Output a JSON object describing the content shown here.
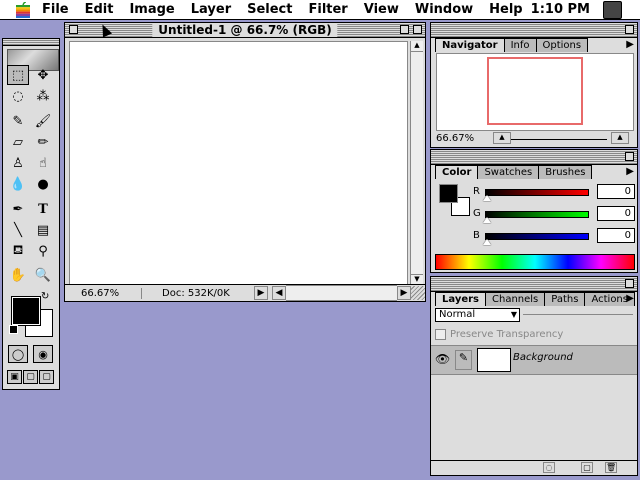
{
  "menubar": {
    "items": [
      "File",
      "Edit",
      "Image",
      "Layer",
      "Select",
      "Filter",
      "View",
      "Window",
      "Help"
    ],
    "clock": "1:10 PM"
  },
  "document": {
    "title": "Untitled-1 @ 66.7% (RGB)",
    "zoom": "66.67%",
    "doc_size": "Doc: 532K/0K"
  },
  "navigator": {
    "tabs": [
      "Navigator",
      "Info",
      "Options"
    ],
    "zoom": "66.67%"
  },
  "color": {
    "tabs": [
      "Color",
      "Swatches",
      "Brushes"
    ],
    "r_label": "R",
    "g_label": "G",
    "b_label": "B",
    "r_value": "0",
    "g_value": "0",
    "b_value": "0"
  },
  "layers": {
    "tabs": [
      "Layers",
      "Channels",
      "Paths",
      "Actions"
    ],
    "blend_mode": "Normal",
    "preserve_label": "Preserve Transparency",
    "layer_name": "Background"
  },
  "colors": {
    "desktop": "#9999cc",
    "nav_rect": "#e86a6a"
  }
}
